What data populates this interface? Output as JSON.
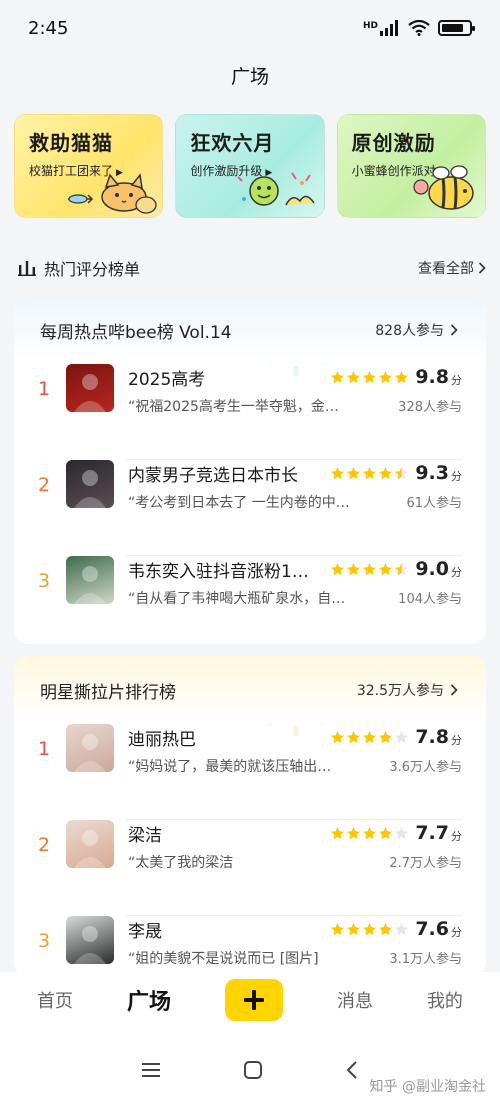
{
  "status": {
    "time": "2:45",
    "hd": "HD",
    "battery_level": 0.8
  },
  "header": {
    "title": "广场"
  },
  "banners": [
    {
      "title": "救助猫猫",
      "subtitle": "校猫打工团来了"
    },
    {
      "title": "狂欢六月",
      "subtitle": "创作激励升级"
    },
    {
      "title": "原创激励",
      "subtitle": "小蜜蜂创作派对"
    }
  ],
  "section": {
    "title": "热门评分榜单",
    "view_all": "查看全部"
  },
  "lists": [
    {
      "title": "每周热点哔bee榜 Vol.14",
      "count": "828人参与",
      "items": [
        {
          "rank": "1",
          "title": "2025高考",
          "rating": 5,
          "score": "9.8",
          "unit": "分",
          "quote": "“祝福2025高考生一举夺魁，金…",
          "participants": "328人参与"
        },
        {
          "rank": "2",
          "title": "内蒙男子竞选日本市长",
          "rating": 4.5,
          "score": "9.3",
          "unit": "分",
          "quote": "“考公考到日本去了 一生内卷的中…",
          "participants": "61人参与"
        },
        {
          "rank": "3",
          "title": "韦东奕入驻抖音涨粉1…",
          "rating": 4.5,
          "score": "9.0",
          "unit": "分",
          "quote": "“自从看了韦神喝大瓶矿泉水，自…",
          "participants": "104人参与"
        }
      ]
    },
    {
      "title": "明星撕拉片排行榜",
      "count": "32.5万人参与",
      "items": [
        {
          "rank": "1",
          "title": "迪丽热巴",
          "rating": 4,
          "score": "7.8",
          "unit": "分",
          "quote": "“妈妈说了，最美的就该压轴出…",
          "participants": "3.6万人参与"
        },
        {
          "rank": "2",
          "title": "梁洁",
          "rating": 4,
          "score": "7.7",
          "unit": "分",
          "quote": "“太美了我的梁洁",
          "participants": "2.7万人参与"
        },
        {
          "rank": "3",
          "title": "李晟",
          "rating": 4,
          "score": "7.6",
          "unit": "分",
          "quote": "“姐的美貌不是说说而已 [图片]",
          "participants": "3.1万人参与"
        }
      ]
    }
  ],
  "nav": {
    "home": "首页",
    "square": "广场",
    "messages": "消息",
    "me": "我的"
  },
  "watermark": "知乎 @副业淘金社",
  "colors": {
    "accent": "#ffd400",
    "star": "#ffc400",
    "rank_1": "#e5533d",
    "rank_2": "#f2772e",
    "rank_3": "#e9a430"
  },
  "icons": [
    "signal-icon",
    "wifi-icon",
    "battery-icon",
    "chart-bars-icon",
    "chevron-right-icon",
    "star-icon",
    "plus-icon",
    "menu-icon",
    "home-square-icon",
    "back-icon"
  ]
}
